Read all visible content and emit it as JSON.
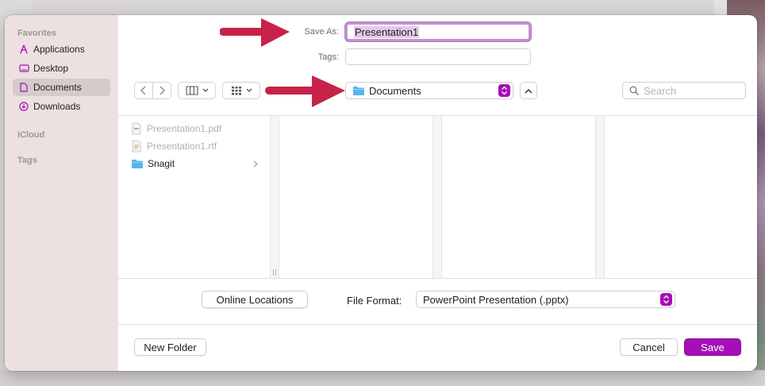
{
  "sidebar": {
    "favorites_heading": "Favorites",
    "items": [
      {
        "label": "Applications",
        "icon": "applications-icon"
      },
      {
        "label": "Desktop",
        "icon": "desktop-icon"
      },
      {
        "label": "Documents",
        "icon": "document-icon",
        "selected": true
      },
      {
        "label": "Downloads",
        "icon": "downloads-icon"
      }
    ],
    "icloud_heading": "iCloud",
    "tags_heading": "Tags"
  },
  "form": {
    "save_as_label": "Save As:",
    "save_as_value": "Presentation1",
    "tags_label": "Tags:",
    "tags_value": ""
  },
  "toolbar": {
    "location": "Documents",
    "search_placeholder": "Search"
  },
  "files": [
    {
      "name": "Presentation1.pdf",
      "dimmed": true,
      "icon": "pdf-file-icon"
    },
    {
      "name": "Presentation1.rtf",
      "dimmed": true,
      "icon": "rtf-file-icon"
    },
    {
      "name": "Snagit",
      "dimmed": false,
      "icon": "folder-icon",
      "has_children": true
    }
  ],
  "options": {
    "online_locations_label": "Online Locations",
    "file_format_label": "File Format:",
    "file_format_value": "PowerPoint Presentation (.pptx)"
  },
  "footer": {
    "new_folder_label": "New Folder",
    "cancel_label": "Cancel",
    "save_label": "Save"
  },
  "colors": {
    "accent": "#a40fb6",
    "annotation_arrow": "#c8224a",
    "sidebar_bg": "#ede0e0",
    "folder": "#5ab4ec"
  }
}
